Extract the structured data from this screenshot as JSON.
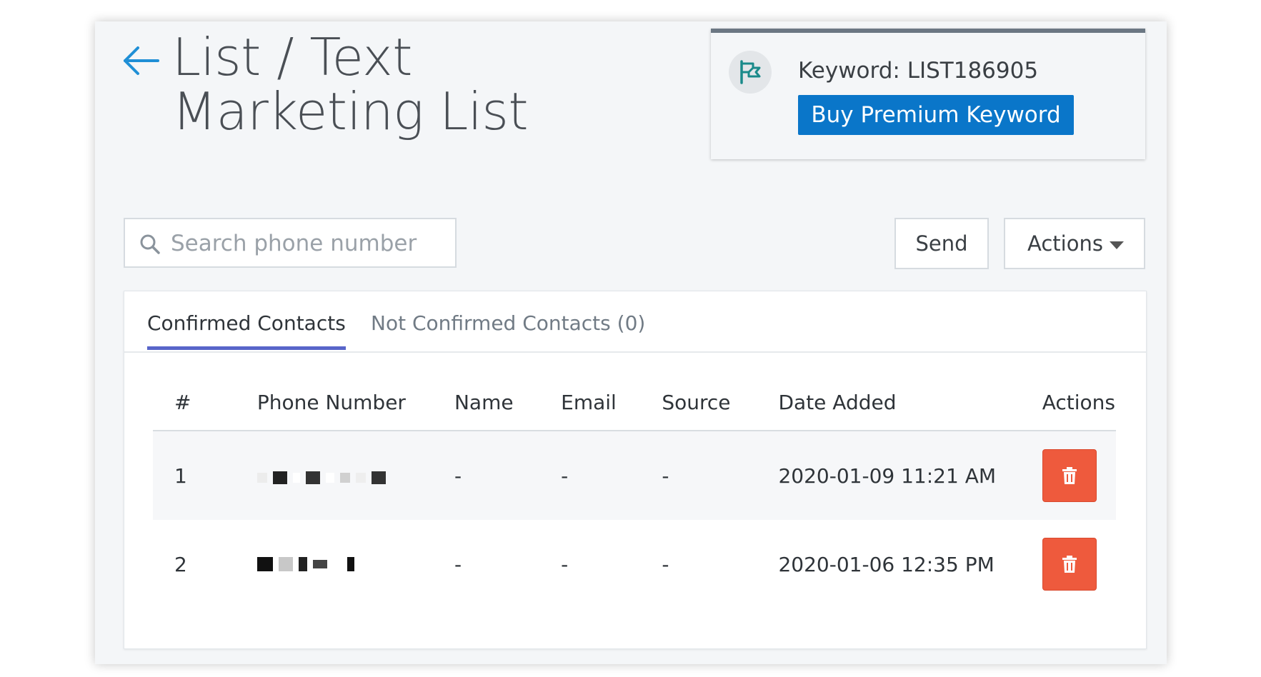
{
  "header": {
    "title_line1": "List / Text",
    "title_line2": "Marketing List"
  },
  "keyword_card": {
    "keyword_text": "Keyword: LIST186905",
    "buy_label": "Buy Premium Keyword"
  },
  "search": {
    "placeholder": "Search phone number"
  },
  "toolbar": {
    "send_label": "Send",
    "actions_label": "Actions"
  },
  "tabs": [
    {
      "label": "Confirmed Contacts",
      "active": true
    },
    {
      "label": "Not Confirmed Contacts (0)",
      "active": false
    }
  ],
  "table": {
    "columns": [
      "#",
      "Phone Number",
      "Name",
      "Email",
      "Source",
      "Date Added",
      "Actions"
    ],
    "rows": [
      {
        "num": "1",
        "name": "-",
        "email": "-",
        "source": "-",
        "date_added": "2020-01-09 11:21 AM"
      },
      {
        "num": "2",
        "name": "-",
        "email": "-",
        "source": "-",
        "date_added": "2020-01-06 12:35 PM"
      }
    ]
  },
  "colors": {
    "accent_blue": "#0a76c9",
    "tab_underline": "#5865c9",
    "delete_red": "#ee5a3d",
    "flag_teal": "#1a8a8a"
  }
}
